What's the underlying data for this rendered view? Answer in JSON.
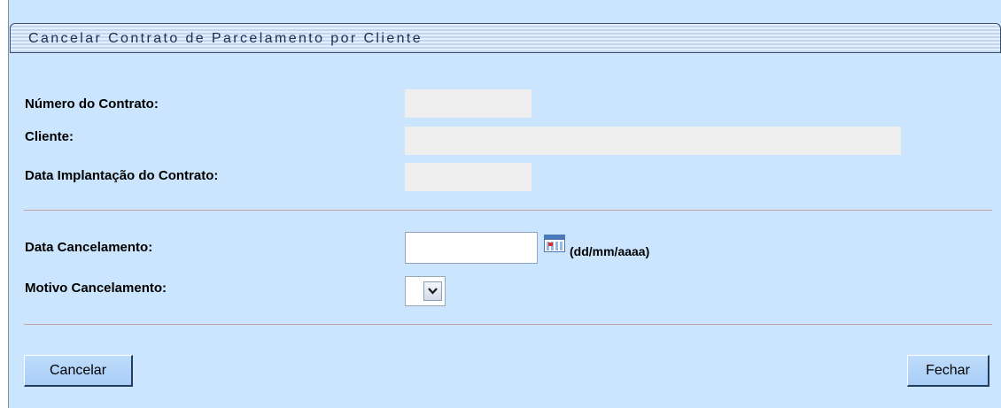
{
  "window": {
    "title": "Cancelar Contrato de Parcelamento por Cliente"
  },
  "contract_info": {
    "numero_label": "Número do Contrato:",
    "numero_value": "",
    "cliente_label": "Cliente:",
    "cliente_value": "",
    "data_implantacao_label": "Data Implantação do Contrato:",
    "data_implantacao_value": ""
  },
  "cancel_form": {
    "data_cancelamento_label": "Data Cancelamento:",
    "data_cancelamento_value": "",
    "date_format_hint": "(dd/mm/aaaa)",
    "motivo_label": "Motivo Cancelamento:",
    "motivo_selected": ""
  },
  "buttons": {
    "cancelar": "Cancelar",
    "fechar": "Fechar"
  },
  "icons": {
    "calendar": "calendar-icon",
    "dropdown": "chevron-down-icon"
  },
  "colors": {
    "panel_background": "#cbe5fe",
    "readonly_field": "#eeeeee",
    "divider": "#c2a4a4",
    "button_face": "#a7cdf7"
  }
}
